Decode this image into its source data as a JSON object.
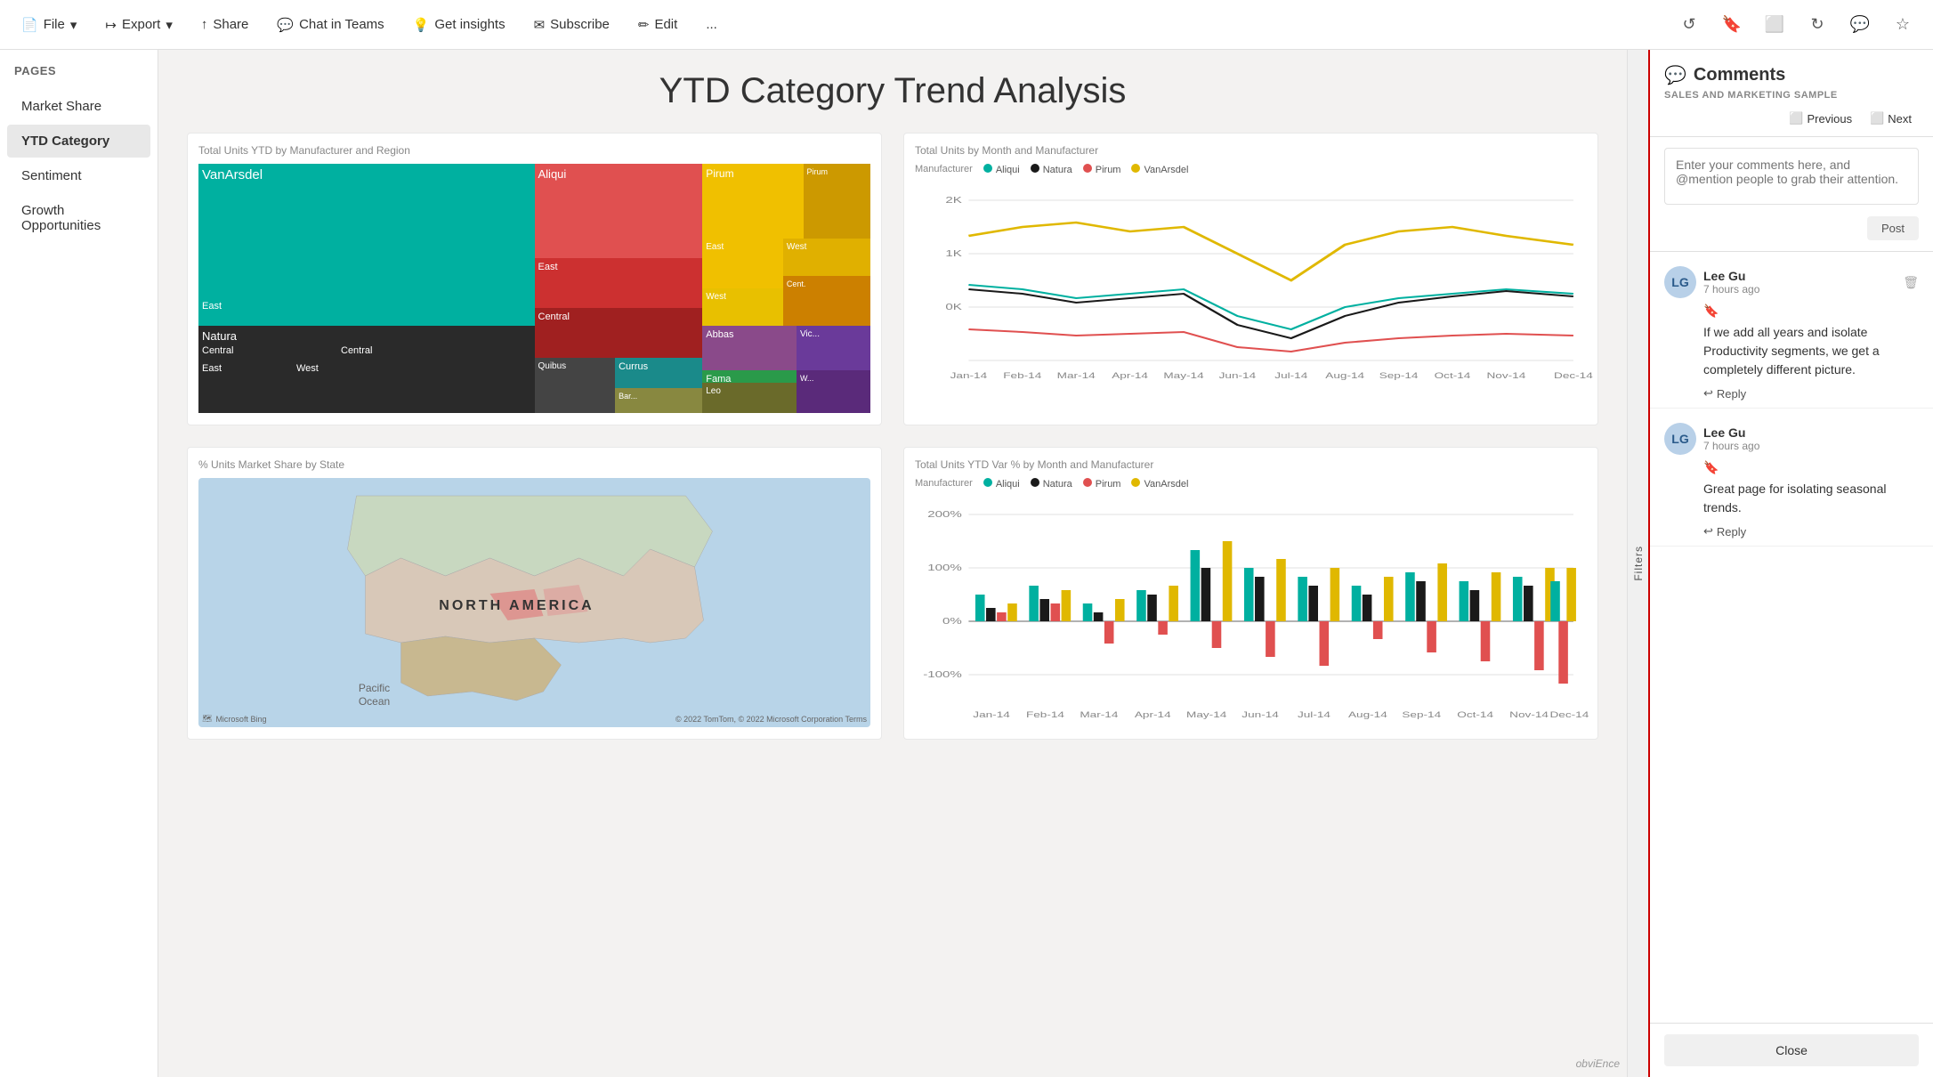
{
  "toolbar": {
    "file_label": "File",
    "export_label": "Export",
    "share_label": "Share",
    "chat_in_teams_label": "Chat in Teams",
    "get_insights_label": "Get insights",
    "subscribe_label": "Subscribe",
    "edit_label": "Edit",
    "more_label": "..."
  },
  "sidebar": {
    "title": "Pages",
    "items": [
      {
        "label": "Market Share",
        "active": false
      },
      {
        "label": "YTD Category",
        "active": true
      },
      {
        "label": "Sentiment",
        "active": false
      },
      {
        "label": "Growth Opportunities",
        "active": false
      }
    ]
  },
  "canvas": {
    "title": "YTD Category Trend Analysis",
    "chart1": {
      "title": "Total Units YTD by Manufacturer and Region",
      "legend": []
    },
    "chart2": {
      "title": "Total Units by Month and Manufacturer",
      "legend": [
        {
          "label": "Aliqui",
          "color": "#00b0a0"
        },
        {
          "label": "Natura",
          "color": "#1a1a1a"
        },
        {
          "label": "Pirum",
          "color": "#e05050"
        },
        {
          "label": "VanArsdel",
          "color": "#e0b800"
        }
      ]
    },
    "chart3": {
      "title": "% Units Market Share by State",
      "map_label": "NORTH AMERICA",
      "pacific_label": "Pacific",
      "ocean_label": "Ocean",
      "bing_label": "Microsoft Bing",
      "copyright": "© 2022 TomTom, © 2022 Microsoft Corporation  Terms"
    },
    "chart4": {
      "title": "Total Units YTD Var % by Month and Manufacturer",
      "legend": [
        {
          "label": "Aliqui",
          "color": "#00b0a0"
        },
        {
          "label": "Natura",
          "color": "#1a1a1a"
        },
        {
          "label": "Pirum",
          "color": "#e05050"
        },
        {
          "label": "VanArsdel",
          "color": "#e0b800"
        }
      ]
    },
    "watermark": "obviEnce"
  },
  "filters": {
    "label": "Filters"
  },
  "comments": {
    "title": "Comments",
    "subtitle": "SALES AND MARKETING SAMPLE",
    "nav": {
      "previous_label": "Previous",
      "next_label": "Next"
    },
    "input_placeholder": "Enter your comments here, and @mention people to grab their attention.",
    "post_label": "Post",
    "items": [
      {
        "author": "Lee Gu",
        "time": "7 hours ago",
        "text": "If we add all years and isolate Productivity segments, we get a completely different picture.",
        "reply_label": "Reply",
        "initials": "LG"
      },
      {
        "author": "Lee Gu",
        "time": "7 hours ago",
        "text": "Great page for isolating seasonal trends.",
        "reply_label": "Reply",
        "initials": "LG"
      }
    ],
    "close_label": "Close"
  }
}
